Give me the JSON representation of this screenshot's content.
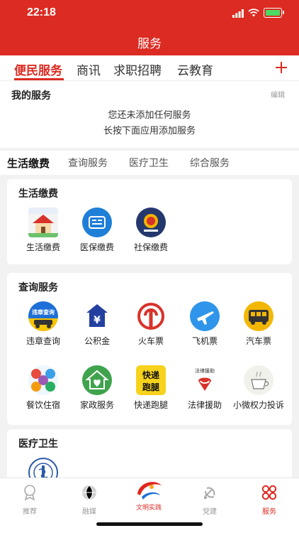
{
  "status": {
    "time": "22:18"
  },
  "nav": {
    "title": "服务"
  },
  "top_tabs": [
    "便民服务",
    "商讯",
    "求职招聘",
    "云教育"
  ],
  "my_services": {
    "title": "我的服务",
    "edit": "编辑",
    "empty_line1": "您还未添加任何服务",
    "empty_line2": "长按下面应用添加服务"
  },
  "category_tabs": [
    "生活缴费",
    "查询服务",
    "医疗卫生",
    "综合服务"
  ],
  "sections": {
    "life": {
      "title": "生活缴费",
      "items": [
        "生活缴费",
        "医保缴费",
        "社保缴费"
      ]
    },
    "query": {
      "title": "查询服务",
      "items": [
        "违章查询",
        "公积金",
        "火车票",
        "飞机票",
        "汽车票",
        "餐饮住宿",
        "家政服务",
        "快递跑腿",
        "法律援助",
        "小微权力投诉"
      ]
    },
    "medical": {
      "title": "医疗卫生"
    }
  },
  "icon_texts": {
    "violation": "违章查询",
    "express_top": "快递",
    "express_bottom": "跑腿",
    "law": "法律援助",
    "news": "NEWS",
    "civil": "文明实践"
  },
  "tabbar": [
    "推荐",
    "融媒",
    "文明实践",
    "党建",
    "服务"
  ],
  "colors": {
    "brand": "#dc2b22"
  }
}
